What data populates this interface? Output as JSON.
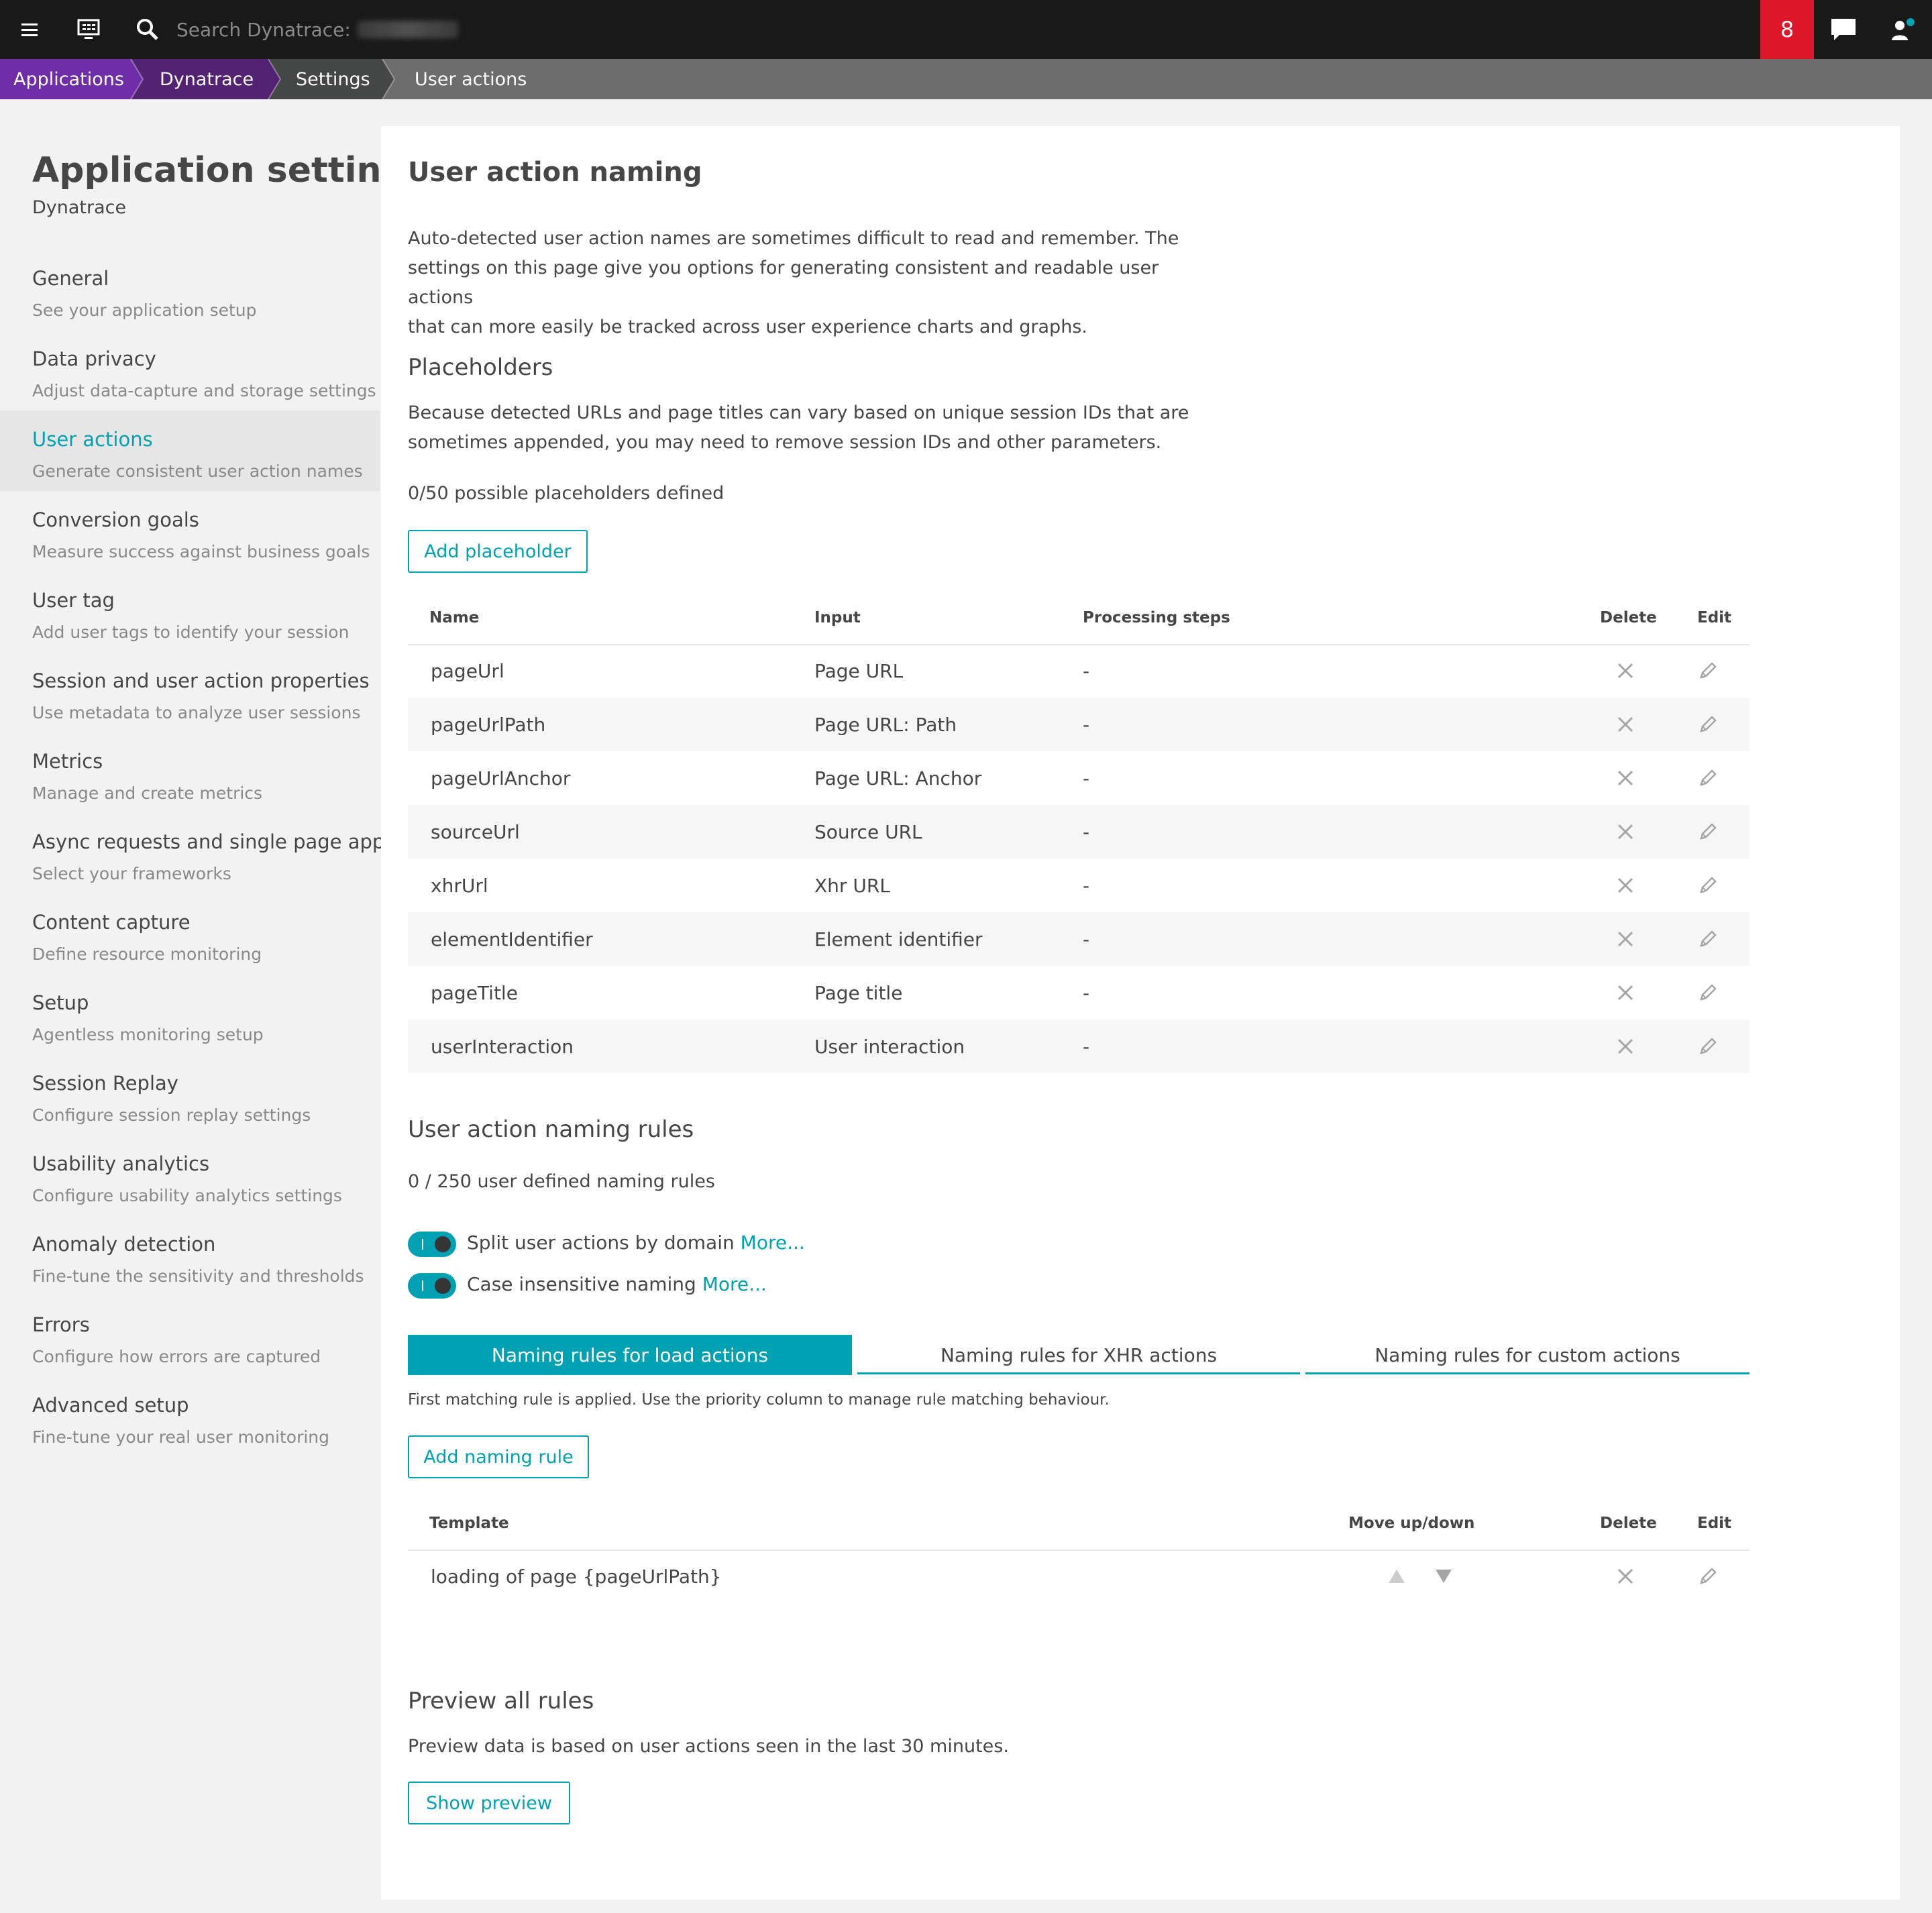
{
  "topbar": {
    "menu_icon": "hamburger-menu-icon",
    "monitor_icon": "monitor-icon",
    "search_icon": "search-icon",
    "search_placeholder": "Search Dynatrace:",
    "notification_count": "8",
    "chat_icon": "chat-icon",
    "user_icon": "user-icon"
  },
  "breadcrumb": {
    "items": [
      "Applications",
      "Dynatrace",
      "Settings",
      "User actions"
    ]
  },
  "sidebar": {
    "title": "Application settings",
    "subtitle": "Dynatrace",
    "items": [
      {
        "label": "General",
        "desc": "See your application setup"
      },
      {
        "label": "Data privacy",
        "desc": "Adjust data-capture and storage settings"
      },
      {
        "label": "User actions",
        "desc": "Generate consistent user action names"
      },
      {
        "label": "Conversion goals",
        "desc": "Measure success against business goals"
      },
      {
        "label": "User tag",
        "desc": "Add user tags to identify your session"
      },
      {
        "label": "Session and user action properties",
        "desc": "Use metadata to analyze user sessions"
      },
      {
        "label": "Metrics",
        "desc": "Manage and create metrics"
      },
      {
        "label": "Async requests and single page apps",
        "desc": "Select your frameworks"
      },
      {
        "label": "Content capture",
        "desc": "Define resource monitoring"
      },
      {
        "label": "Setup",
        "desc": "Agentless monitoring setup"
      },
      {
        "label": "Session Replay",
        "desc": "Configure session replay settings"
      },
      {
        "label": "Usability analytics",
        "desc": "Configure usability analytics settings"
      },
      {
        "label": "Anomaly detection",
        "desc": "Fine-tune the sensitivity and thresholds"
      },
      {
        "label": "Errors",
        "desc": "Configure how errors are captured"
      },
      {
        "label": "Advanced setup",
        "desc": "Fine-tune your real user monitoring"
      }
    ]
  },
  "main": {
    "title": "User action naming",
    "intro_lines": [
      "Auto-detected user action names are sometimes difficult to read and remember. The",
      "settings on this page give you options for generating consistent and readable user actions",
      "that can more easily be tracked across user experience charts and graphs."
    ],
    "placeholders": {
      "title": "Placeholders",
      "desc_lines": [
        "Because detected URLs and page titles can vary based on unique session IDs that are",
        "sometimes appended, you may need to remove session IDs and other parameters."
      ],
      "count_text": "0/50 possible placeholders defined",
      "add_button": "Add placeholder",
      "columns": [
        "Name",
        "Input",
        "Processing steps",
        "Delete",
        "Edit"
      ],
      "rows": [
        {
          "name": "pageUrl",
          "input": "Page URL",
          "steps": "-"
        },
        {
          "name": "pageUrlPath",
          "input": "Page URL: Path",
          "steps": "-"
        },
        {
          "name": "pageUrlAnchor",
          "input": "Page URL: Anchor",
          "steps": "-"
        },
        {
          "name": "sourceUrl",
          "input": "Source URL",
          "steps": "-"
        },
        {
          "name": "xhrUrl",
          "input": "Xhr URL",
          "steps": "-"
        },
        {
          "name": "elementIdentifier",
          "input": "Element identifier",
          "steps": "-"
        },
        {
          "name": "pageTitle",
          "input": "Page title",
          "steps": "-"
        },
        {
          "name": "userInteraction",
          "input": "User interaction",
          "steps": "-"
        }
      ]
    },
    "naming_rules": {
      "title": "User action naming rules",
      "count_text": "0 / 250 user defined naming rules",
      "toggles": [
        {
          "label": "Split user actions by domain",
          "more": "More...",
          "on": true
        },
        {
          "label": "Case insensitive naming",
          "more": "More...",
          "on": true
        }
      ],
      "tabs": [
        "Naming rules for load actions",
        "Naming rules for XHR actions",
        "Naming rules for custom actions"
      ],
      "active_tab": 0,
      "note": "First matching rule is applied. Use the priority column to manage rule matching behaviour.",
      "add_button": "Add naming rule",
      "columns": [
        "Template",
        "Move up/down",
        "Delete",
        "Edit"
      ],
      "rows": [
        {
          "template": "loading of page {pageUrlPath}"
        }
      ]
    },
    "preview": {
      "title": "Preview all rules",
      "desc": "Preview data is based on user actions seen in the last 30 minutes.",
      "button": "Show preview"
    }
  },
  "colors": {
    "accent": "#00a1b2",
    "topbar": "#191919",
    "notification": "#dc172a",
    "breadcrumb_purple": "#6f2da8",
    "breadcrumb_purple_dark": "#522273",
    "breadcrumb_dark": "#454646",
    "breadcrumb_bar": "#6d6d6d"
  }
}
